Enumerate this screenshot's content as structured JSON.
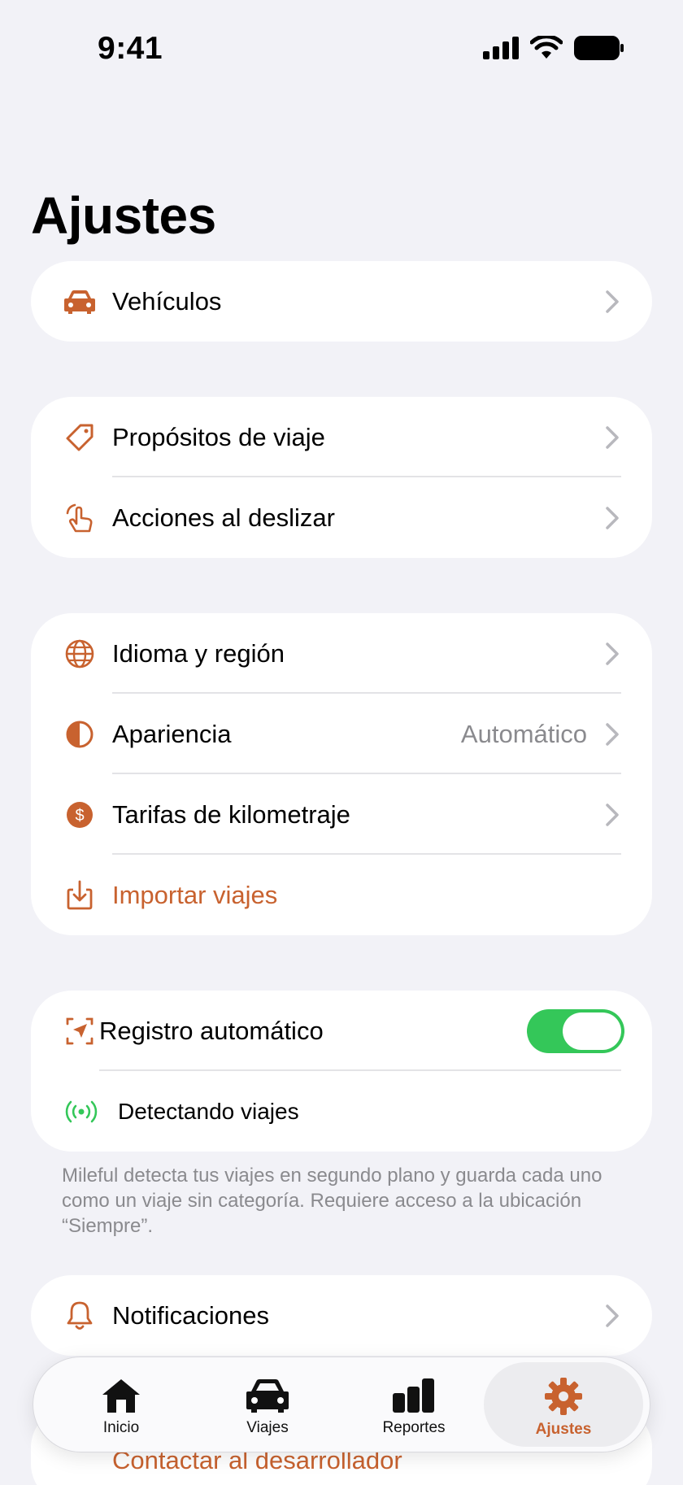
{
  "status": {
    "time": "9:41"
  },
  "title": "Ajustes",
  "colors": {
    "accent": "#c8622f",
    "toggle_on": "#34c759",
    "secondary": "#8a8a8e"
  },
  "group1": [
    {
      "label": "Vehículos",
      "icon": "car-icon"
    }
  ],
  "group2": [
    {
      "label": "Propósitos de viaje",
      "icon": "tag-icon"
    },
    {
      "label": "Acciones al deslizar",
      "icon": "hand-swipe-icon"
    }
  ],
  "group3": [
    {
      "label": "Idioma y región",
      "icon": "globe-icon"
    },
    {
      "label": "Apariencia",
      "value": "Automático",
      "icon": "half-circle-icon"
    },
    {
      "label": "Tarifas de kilometraje",
      "icon": "dollar-circle-icon"
    },
    {
      "label": "Importar viajes",
      "icon": "import-icon"
    }
  ],
  "group4": {
    "auto_label": "Registro automático",
    "auto_on": true,
    "detect_label": "Detectando viajes",
    "footnote": "Mileful detecta tus viajes en segundo plano y guarda cada uno como un viaje sin categoría. Requiere acceso a la ubicación “Siempre”."
  },
  "group5": [
    {
      "label": "Notificaciones",
      "icon": "bell-icon"
    }
  ],
  "peek": {
    "label": "Contactar al desarrollador"
  },
  "tabs": [
    {
      "label": "Inicio",
      "icon": "house-icon"
    },
    {
      "label": "Viajes",
      "icon": "car-icon"
    },
    {
      "label": "Reportes",
      "icon": "bar-chart-icon"
    },
    {
      "label": "Ajustes",
      "icon": "gear-icon",
      "active": true
    }
  ]
}
